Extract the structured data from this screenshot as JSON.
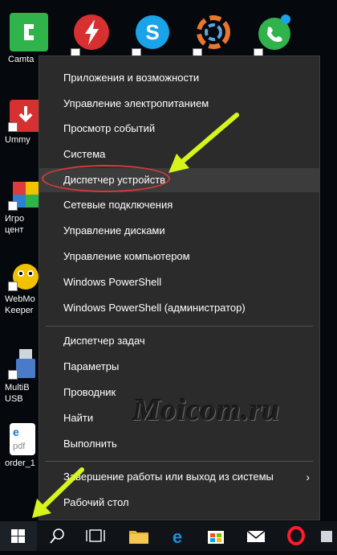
{
  "desktop": {
    "icons": [
      {
        "label": "Camta",
        "color": "#2fb34a"
      },
      {
        "label": "Ummy",
        "color": "#d63031"
      },
      {
        "label": "Игро",
        "label2": "цент",
        "color": "#e0a020"
      },
      {
        "label": "WebMo",
        "label2": "Keeper",
        "color": "#f2c200"
      },
      {
        "label": "MultiB",
        "label2": "USB",
        "color": "#4a7bc8"
      },
      {
        "label": "order_1",
        "color": "#ffffff"
      }
    ]
  },
  "menu": {
    "items": [
      {
        "label": "Приложения и возможности"
      },
      {
        "label": "Управление электропитанием"
      },
      {
        "label": "Просмотр событий"
      },
      {
        "label": "Система"
      },
      {
        "label": "Диспетчер устройств"
      },
      {
        "label": "Сетевые подключения"
      },
      {
        "label": "Управление дисками"
      },
      {
        "label": "Управление компьютером"
      },
      {
        "label": "Windows PowerShell"
      },
      {
        "label": "Windows PowerShell (администратор)"
      },
      {
        "label": "Диспетчер задач"
      },
      {
        "label": "Параметры"
      },
      {
        "label": "Проводник"
      },
      {
        "label": "Найти"
      },
      {
        "label": "Выполнить"
      },
      {
        "label": "Завершение работы или выход из системы"
      },
      {
        "label": "Рабочий стол"
      }
    ],
    "submenu_glyph": "›"
  },
  "watermark": "Moicom.ru",
  "colors": {
    "menu_bg": "#2b2b2b",
    "highlight": "#3c3c3c",
    "ellipse": "#d43a3a",
    "arrow": "#d7f51c",
    "taskbar": "#101317"
  },
  "taskbar": {
    "icons": [
      "windows-start-icon",
      "search-icon",
      "task-view-icon",
      "file-explorer-icon",
      "edge-icon",
      "store-icon",
      "mail-icon",
      "opera-icon"
    ]
  }
}
